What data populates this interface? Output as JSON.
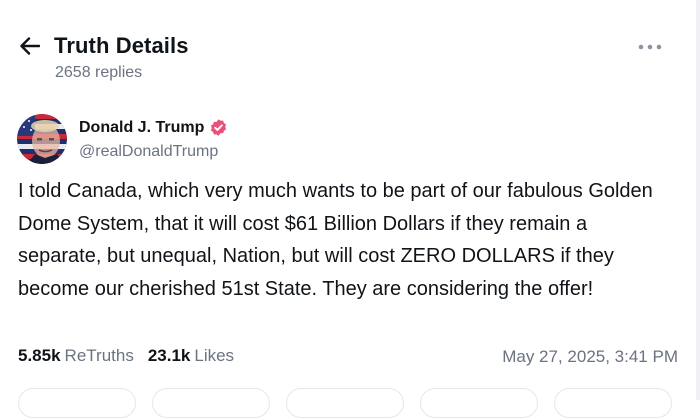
{
  "header": {
    "title": "Truth Details",
    "replies": "2658 replies",
    "back_icon": "arrow-left-icon",
    "more_icon": "more-horizontal-icon"
  },
  "post": {
    "author_name": "Donald J. Trump",
    "handle": "@realDonaldTrump",
    "verified_icon": "verified-badge-icon",
    "text": "I told Canada, which very much wants to be part of our fabulous Golden Dome System, that it will cost $61 Billion Dollars if they remain a separate, but unequal, Nation, but will cost ZERO DOLLARS if they become our cherished 51st State. They are considering the offer!",
    "retruths_count": "5.85k",
    "retruths_label": "ReTruths",
    "likes_count": "23.1k",
    "likes_label": "Likes",
    "timestamp": "May 27, 2025, 3:41 PM"
  },
  "colors": {
    "accent_verified": "#e5527a",
    "muted_text": "#6b7280",
    "primary_text": "#0f1419"
  }
}
